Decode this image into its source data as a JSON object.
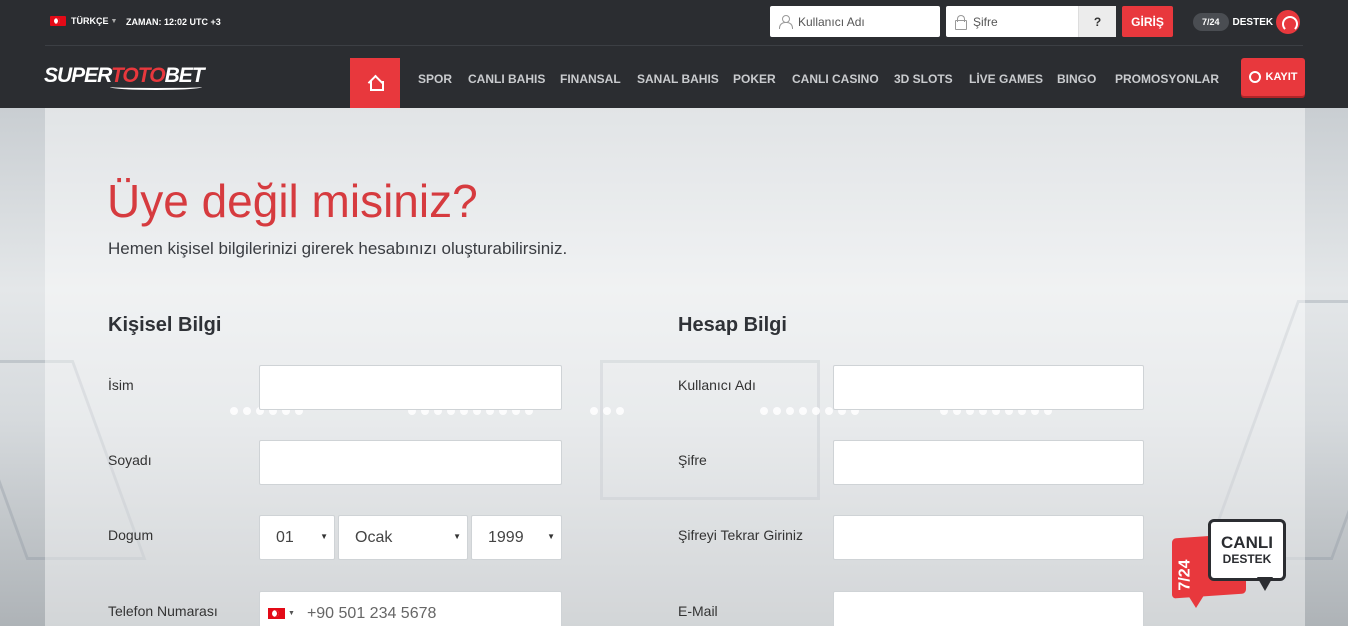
{
  "topbar": {
    "language": "TÜRKÇE",
    "time": "ZAMAN: 12:02 UTC +3",
    "username_placeholder": "Kullanıcı Adı",
    "password_placeholder": "Şifre",
    "help_label": "?",
    "login_label": "GİRİŞ",
    "support_hours": "7/24",
    "support_label": "DESTEK"
  },
  "logo": {
    "part1": "SUPER",
    "part2": "TOTO",
    "part3": "BET"
  },
  "nav": {
    "items": [
      "SPOR",
      "CANLI BAHIS",
      "FINANSAL",
      "SANAL BAHIS",
      "POKER",
      "CANLI CASINO",
      "3D SLOTS",
      "LİVE GAMES",
      "BINGO",
      "PROMOSYONLAR"
    ],
    "register_label": "KAYIT"
  },
  "form": {
    "title": "Üye değil misiniz?",
    "subtitle": "Hemen kişisel bilgilerinizi girerek hesabınızı oluşturabilirsiniz.",
    "personal": {
      "heading": "Kişisel Bilgi",
      "name_label": "İsim",
      "surname_label": "Soyadı",
      "birth_label": "Dogum",
      "birth_day": "01",
      "birth_month": "Ocak",
      "birth_year": "1999",
      "phone_label": "Telefon Numarası",
      "phone_placeholder": "+90 501 234 5678"
    },
    "account": {
      "heading": "Hesap Bilgi",
      "username_label": "Kullanıcı Adı",
      "password_label": "Şifre",
      "password_repeat_label": "Şifreyi Tekrar Giriniz",
      "email_label": "E-Mail"
    }
  },
  "live_chat": {
    "hours": "7/24",
    "line1": "CANLI",
    "line2": "DESTEK"
  }
}
